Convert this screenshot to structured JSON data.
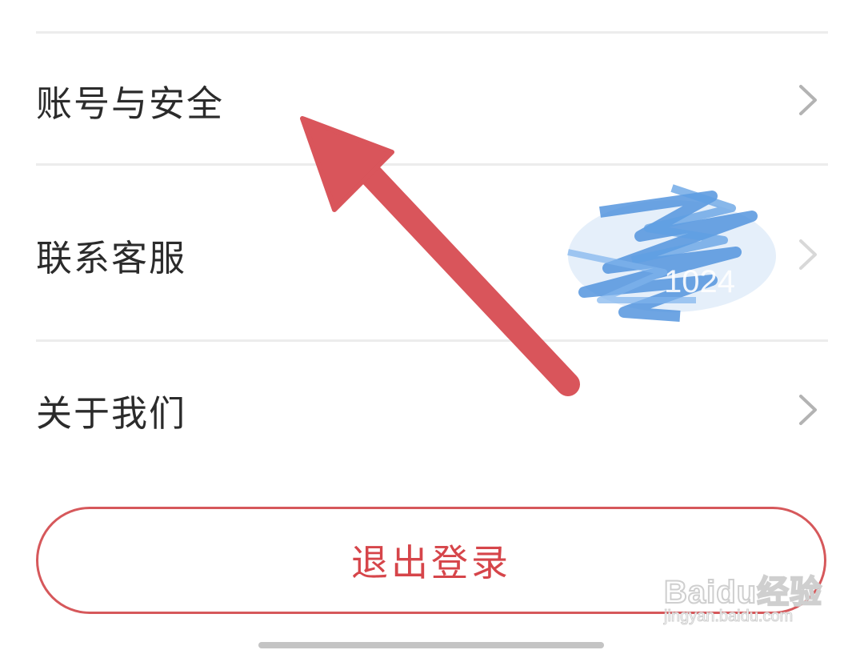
{
  "menu": {
    "items": [
      {
        "label": "账号与安全",
        "icon": "chevron-right-icon"
      },
      {
        "label": "联系客服",
        "icon": "chevron-right-icon",
        "partial_value": "1024"
      },
      {
        "label": "关于我们",
        "icon": "chevron-right-icon"
      }
    ]
  },
  "logout": {
    "label": "退出登录"
  },
  "watermark": {
    "brand": "Baidu经验",
    "url": "jingyan.baidu.com"
  },
  "colors": {
    "accent": "#d6454a",
    "annotation_arrow": "#d9555b",
    "text": "#2b2b2b",
    "divider": "#ececec",
    "chevron": "#b3b3b3"
  }
}
